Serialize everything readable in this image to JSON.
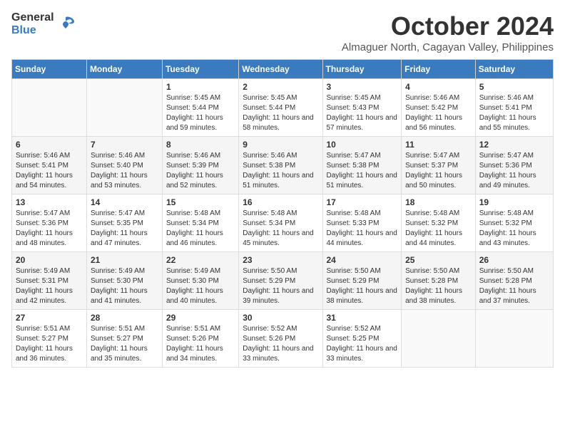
{
  "logo": {
    "general": "General",
    "blue": "Blue"
  },
  "title": "October 2024",
  "subtitle": "Almaguer North, Cagayan Valley, Philippines",
  "days_header": [
    "Sunday",
    "Monday",
    "Tuesday",
    "Wednesday",
    "Thursday",
    "Friday",
    "Saturday"
  ],
  "weeks": [
    [
      {
        "day": "",
        "sunrise": "",
        "sunset": "",
        "daylight": ""
      },
      {
        "day": "",
        "sunrise": "",
        "sunset": "",
        "daylight": ""
      },
      {
        "day": "1",
        "sunrise": "Sunrise: 5:45 AM",
        "sunset": "Sunset: 5:44 PM",
        "daylight": "Daylight: 11 hours and 59 minutes."
      },
      {
        "day": "2",
        "sunrise": "Sunrise: 5:45 AM",
        "sunset": "Sunset: 5:44 PM",
        "daylight": "Daylight: 11 hours and 58 minutes."
      },
      {
        "day": "3",
        "sunrise": "Sunrise: 5:45 AM",
        "sunset": "Sunset: 5:43 PM",
        "daylight": "Daylight: 11 hours and 57 minutes."
      },
      {
        "day": "4",
        "sunrise": "Sunrise: 5:46 AM",
        "sunset": "Sunset: 5:42 PM",
        "daylight": "Daylight: 11 hours and 56 minutes."
      },
      {
        "day": "5",
        "sunrise": "Sunrise: 5:46 AM",
        "sunset": "Sunset: 5:41 PM",
        "daylight": "Daylight: 11 hours and 55 minutes."
      }
    ],
    [
      {
        "day": "6",
        "sunrise": "Sunrise: 5:46 AM",
        "sunset": "Sunset: 5:41 PM",
        "daylight": "Daylight: 11 hours and 54 minutes."
      },
      {
        "day": "7",
        "sunrise": "Sunrise: 5:46 AM",
        "sunset": "Sunset: 5:40 PM",
        "daylight": "Daylight: 11 hours and 53 minutes."
      },
      {
        "day": "8",
        "sunrise": "Sunrise: 5:46 AM",
        "sunset": "Sunset: 5:39 PM",
        "daylight": "Daylight: 11 hours and 52 minutes."
      },
      {
        "day": "9",
        "sunrise": "Sunrise: 5:46 AM",
        "sunset": "Sunset: 5:38 PM",
        "daylight": "Daylight: 11 hours and 51 minutes."
      },
      {
        "day": "10",
        "sunrise": "Sunrise: 5:47 AM",
        "sunset": "Sunset: 5:38 PM",
        "daylight": "Daylight: 11 hours and 51 minutes."
      },
      {
        "day": "11",
        "sunrise": "Sunrise: 5:47 AM",
        "sunset": "Sunset: 5:37 PM",
        "daylight": "Daylight: 11 hours and 50 minutes."
      },
      {
        "day": "12",
        "sunrise": "Sunrise: 5:47 AM",
        "sunset": "Sunset: 5:36 PM",
        "daylight": "Daylight: 11 hours and 49 minutes."
      }
    ],
    [
      {
        "day": "13",
        "sunrise": "Sunrise: 5:47 AM",
        "sunset": "Sunset: 5:36 PM",
        "daylight": "Daylight: 11 hours and 48 minutes."
      },
      {
        "day": "14",
        "sunrise": "Sunrise: 5:47 AM",
        "sunset": "Sunset: 5:35 PM",
        "daylight": "Daylight: 11 hours and 47 minutes."
      },
      {
        "day": "15",
        "sunrise": "Sunrise: 5:48 AM",
        "sunset": "Sunset: 5:34 PM",
        "daylight": "Daylight: 11 hours and 46 minutes."
      },
      {
        "day": "16",
        "sunrise": "Sunrise: 5:48 AM",
        "sunset": "Sunset: 5:34 PM",
        "daylight": "Daylight: 11 hours and 45 minutes."
      },
      {
        "day": "17",
        "sunrise": "Sunrise: 5:48 AM",
        "sunset": "Sunset: 5:33 PM",
        "daylight": "Daylight: 11 hours and 44 minutes."
      },
      {
        "day": "18",
        "sunrise": "Sunrise: 5:48 AM",
        "sunset": "Sunset: 5:32 PM",
        "daylight": "Daylight: 11 hours and 44 minutes."
      },
      {
        "day": "19",
        "sunrise": "Sunrise: 5:48 AM",
        "sunset": "Sunset: 5:32 PM",
        "daylight": "Daylight: 11 hours and 43 minutes."
      }
    ],
    [
      {
        "day": "20",
        "sunrise": "Sunrise: 5:49 AM",
        "sunset": "Sunset: 5:31 PM",
        "daylight": "Daylight: 11 hours and 42 minutes."
      },
      {
        "day": "21",
        "sunrise": "Sunrise: 5:49 AM",
        "sunset": "Sunset: 5:30 PM",
        "daylight": "Daylight: 11 hours and 41 minutes."
      },
      {
        "day": "22",
        "sunrise": "Sunrise: 5:49 AM",
        "sunset": "Sunset: 5:30 PM",
        "daylight": "Daylight: 11 hours and 40 minutes."
      },
      {
        "day": "23",
        "sunrise": "Sunrise: 5:50 AM",
        "sunset": "Sunset: 5:29 PM",
        "daylight": "Daylight: 11 hours and 39 minutes."
      },
      {
        "day": "24",
        "sunrise": "Sunrise: 5:50 AM",
        "sunset": "Sunset: 5:29 PM",
        "daylight": "Daylight: 11 hours and 38 minutes."
      },
      {
        "day": "25",
        "sunrise": "Sunrise: 5:50 AM",
        "sunset": "Sunset: 5:28 PM",
        "daylight": "Daylight: 11 hours and 38 minutes."
      },
      {
        "day": "26",
        "sunrise": "Sunrise: 5:50 AM",
        "sunset": "Sunset: 5:28 PM",
        "daylight": "Daylight: 11 hours and 37 minutes."
      }
    ],
    [
      {
        "day": "27",
        "sunrise": "Sunrise: 5:51 AM",
        "sunset": "Sunset: 5:27 PM",
        "daylight": "Daylight: 11 hours and 36 minutes."
      },
      {
        "day": "28",
        "sunrise": "Sunrise: 5:51 AM",
        "sunset": "Sunset: 5:27 PM",
        "daylight": "Daylight: 11 hours and 35 minutes."
      },
      {
        "day": "29",
        "sunrise": "Sunrise: 5:51 AM",
        "sunset": "Sunset: 5:26 PM",
        "daylight": "Daylight: 11 hours and 34 minutes."
      },
      {
        "day": "30",
        "sunrise": "Sunrise: 5:52 AM",
        "sunset": "Sunset: 5:26 PM",
        "daylight": "Daylight: 11 hours and 33 minutes."
      },
      {
        "day": "31",
        "sunrise": "Sunrise: 5:52 AM",
        "sunset": "Sunset: 5:25 PM",
        "daylight": "Daylight: 11 hours and 33 minutes."
      },
      {
        "day": "",
        "sunrise": "",
        "sunset": "",
        "daylight": ""
      },
      {
        "day": "",
        "sunrise": "",
        "sunset": "",
        "daylight": ""
      }
    ]
  ]
}
